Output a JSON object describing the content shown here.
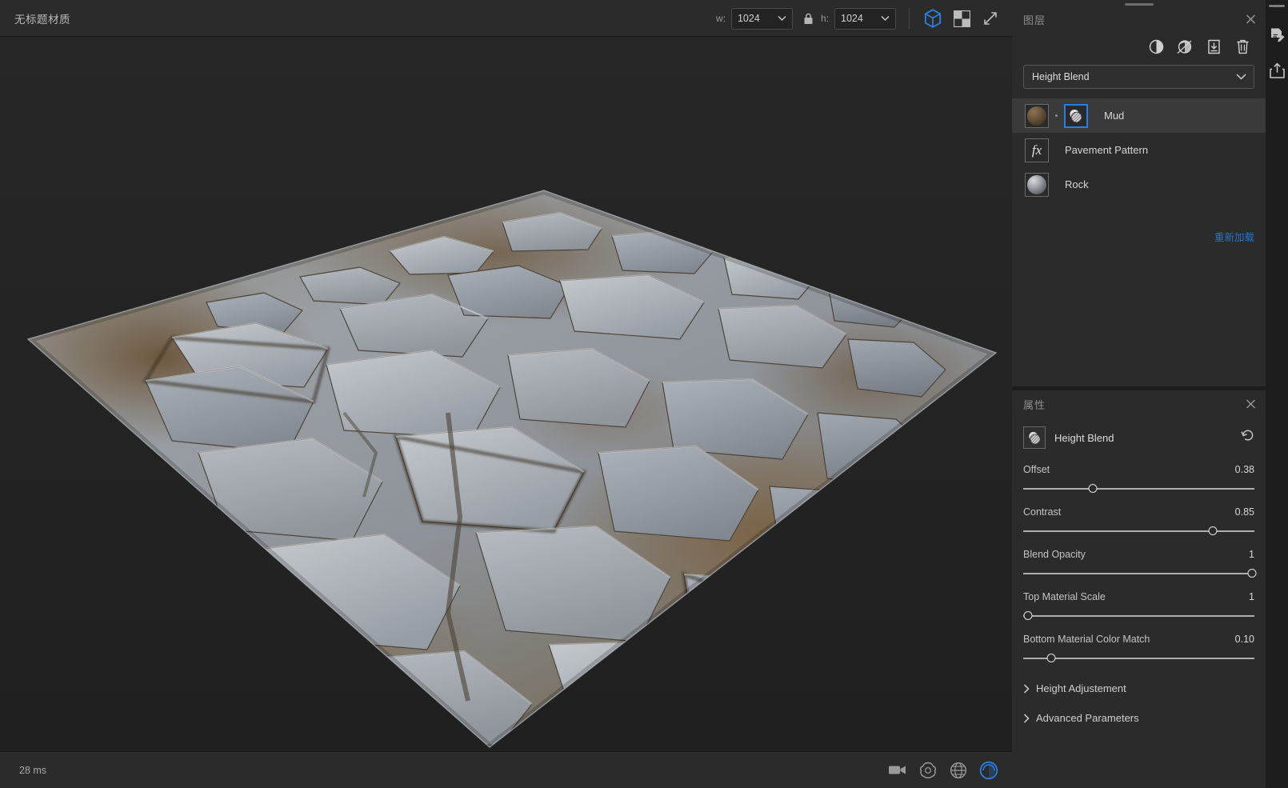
{
  "app": {
    "document_title": "无标题材质"
  },
  "toolbar": {
    "width_label": "w:",
    "width_value": "1024",
    "lock_icon": "lock-icon",
    "height_label": "h:",
    "height_value": "1024",
    "view_3d_icon": "cube-3d-icon",
    "view_2d_icon": "checker-2d-icon",
    "fullscreen_icon": "expand-arrows-icon",
    "accent_color": "#2a7fe0"
  },
  "viewport": {
    "render_label": "3d-plane-preview"
  },
  "status": {
    "render_time": "28 ms",
    "icons": [
      {
        "name": "camera-icon",
        "active": false
      },
      {
        "name": "environment-icon",
        "active": false
      },
      {
        "name": "globe-grid-icon",
        "active": false
      },
      {
        "name": "render-toggle-icon",
        "active": true
      }
    ],
    "active_color": "#2a7fe0"
  },
  "layers_panel": {
    "title": "图层",
    "close_icon": "close-icon",
    "tools": [
      {
        "name": "adjustment-icon"
      },
      {
        "name": "filter-effect-icon"
      },
      {
        "name": "import-layer-icon"
      },
      {
        "name": "delete-layer-icon"
      }
    ],
    "blend_mode": {
      "value": "Height Blend",
      "chevron_icon": "chevron-down-icon"
    },
    "layers": [
      {
        "name": "Mud",
        "thumb": "mud-sphere",
        "mask": "blend-mask-icon",
        "selected": true
      },
      {
        "name": "Pavement Pattern",
        "thumb": "fx",
        "fx_label": "fx",
        "selected": false
      },
      {
        "name": "Rock",
        "thumb": "rock-sphere",
        "selected": false
      }
    ],
    "reload_link": "重新加载",
    "link_color": "#2d73c9"
  },
  "properties_panel": {
    "title": "属性",
    "close_icon": "close-icon",
    "node_icon": "blend-mask-icon",
    "node_name": "Height Blend",
    "reset_icon": "reset-icon",
    "parameters": [
      {
        "label": "Offset",
        "value": "0.38",
        "fill": 30
      },
      {
        "label": "Contrast",
        "value": "0.85",
        "fill": 82
      },
      {
        "label": "Blend Opacity",
        "value": "1",
        "fill": 99
      },
      {
        "label": "Top Material Scale",
        "value": "1",
        "fill": 2
      },
      {
        "label": "Bottom Material Color Match",
        "value": "0.10",
        "fill": 12
      }
    ],
    "sections": [
      {
        "label": "Height Adjustement",
        "expanded": false,
        "chevron_icon": "chevron-right-icon"
      },
      {
        "label": "Advanced Parameters",
        "expanded": false,
        "chevron_icon": "chevron-right-icon"
      }
    ]
  },
  "rail": {
    "items": [
      {
        "name": "document-edit-icon"
      },
      {
        "name": "export-share-icon"
      }
    ]
  }
}
